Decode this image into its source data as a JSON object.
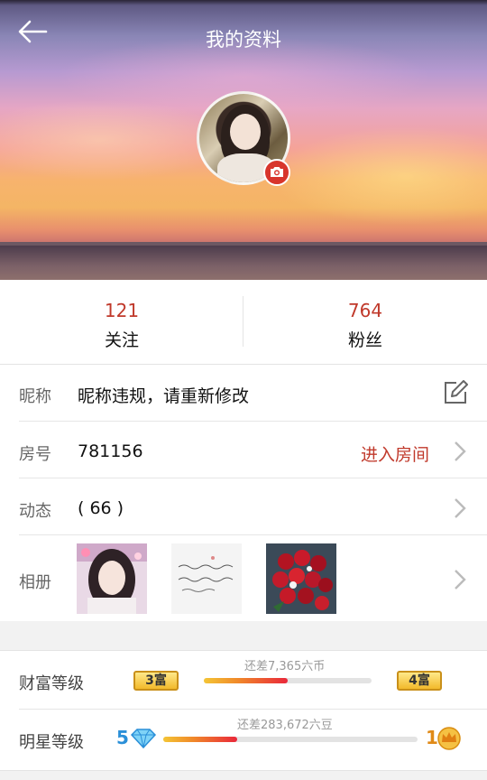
{
  "header": {
    "title": "我的资料",
    "back_icon": "arrow-left-icon",
    "camera_icon": "camera-icon"
  },
  "stats": {
    "following": {
      "count": "121",
      "label": "关注"
    },
    "fans": {
      "count": "764",
      "label": "粉丝"
    }
  },
  "profile": {
    "nickname": {
      "label": "昵称",
      "value": "昵称违规，请重新修改",
      "icon": "edit-icon"
    },
    "room": {
      "label": "房号",
      "value": "781156",
      "action": "进入房间"
    },
    "posts": {
      "label": "动态",
      "value": "( 66 )"
    },
    "album": {
      "label": "相册",
      "photo_count": 3
    }
  },
  "levels": {
    "wealth": {
      "label": "财富等级",
      "current_badge": "3富",
      "next_badge": "4富",
      "diff_text": "还差7,365六币",
      "progress": 0.5
    },
    "star": {
      "label": "明星等级",
      "current_level": "5",
      "current_icon": "diamond-icon",
      "next_level": "1",
      "next_icon": "crown-icon",
      "diff_text": "还差283,672六豆",
      "progress": 0.29
    }
  },
  "colors": {
    "accent": "#c0392b",
    "camera_badge": "#d8352c"
  }
}
